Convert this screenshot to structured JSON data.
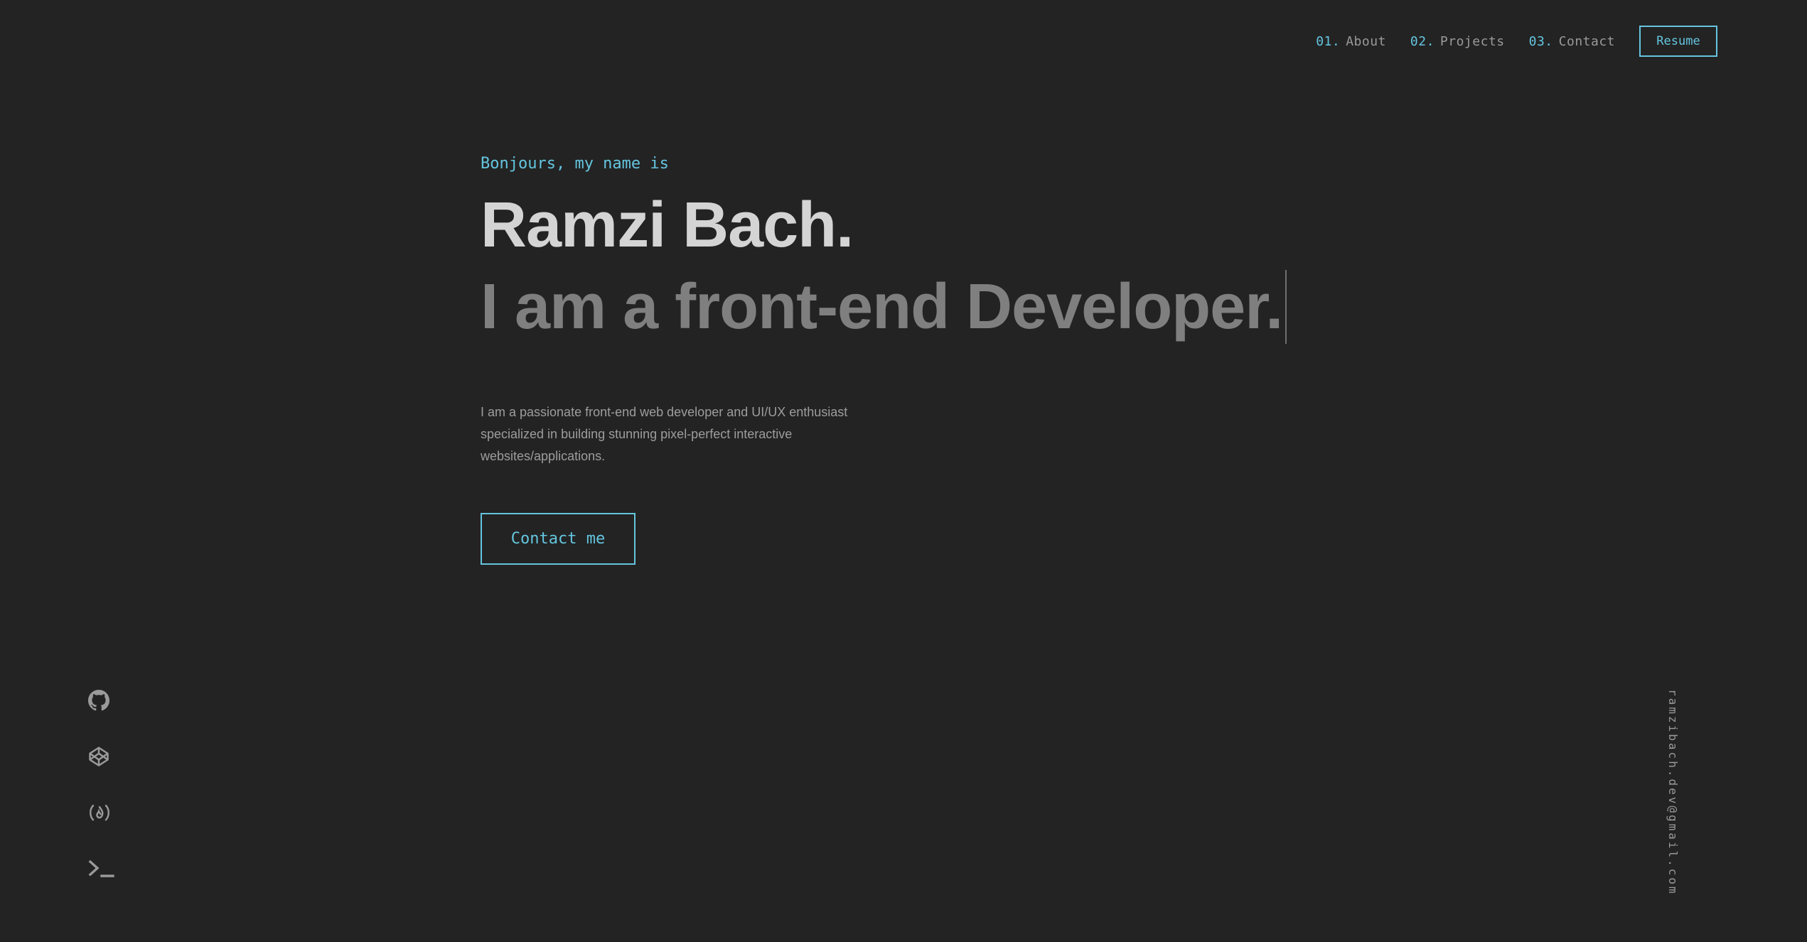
{
  "nav": {
    "items": [
      {
        "num": "01.",
        "label": "About"
      },
      {
        "num": "02.",
        "label": "Projects"
      },
      {
        "num": "03.",
        "label": "Contact"
      }
    ],
    "resume_label": "Resume"
  },
  "hero": {
    "greeting": "Bonjours, my name is",
    "name": "Ramzi Bach.",
    "role": "I am a front-end Developer.",
    "intro": "I am a passionate front-end web developer and UI/UX enthusiast specialized in building stunning pixel-perfect interactive websites/applications.",
    "cta_label": "Contact me"
  },
  "socials": [
    {
      "icon": "github-icon"
    },
    {
      "icon": "codepen-icon"
    },
    {
      "icon": "freecodecamp-icon"
    },
    {
      "icon": "terminal-icon"
    }
  ],
  "email": "ramzibach.dev@gmail.com",
  "colors": {
    "background": "#232323",
    "accent": "#64c5df",
    "heading": "#d4d4d4",
    "subheading": "#7f7f7f",
    "body_text": "#9d9d9d"
  }
}
